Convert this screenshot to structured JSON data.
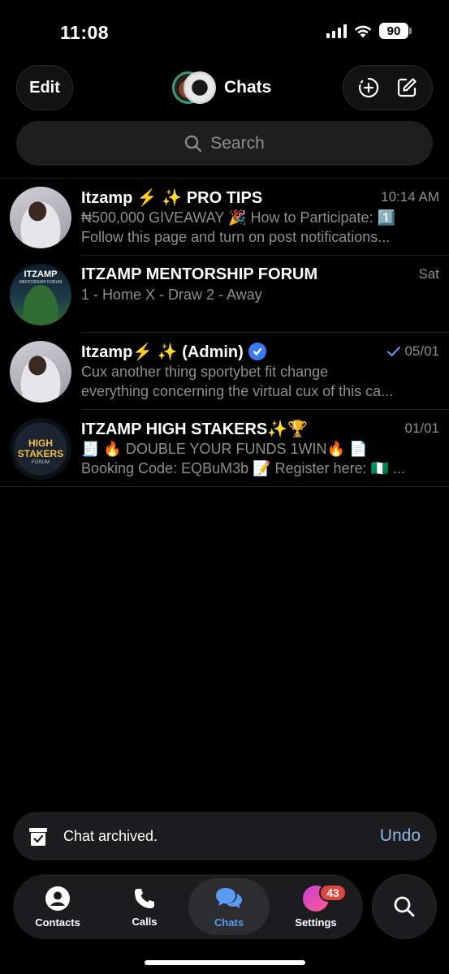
{
  "status_bar": {
    "time": "11:08",
    "battery": "90"
  },
  "header": {
    "edit_label": "Edit",
    "title": "Chats"
  },
  "search": {
    "placeholder": "Search"
  },
  "chats": [
    {
      "name": "Itzamp ⚡️ ✨ PRO TIPS",
      "date": "10:14 AM",
      "line1": "₦500,000 GIVEAWAY 🎉 How to Participate: 1️⃣",
      "line2": "Follow this page and turn on post notifications...",
      "avatar": "sleeping-man"
    },
    {
      "name": "ITZAMP MENTORSHIP FORUM",
      "date": "Sat",
      "line1": "1 - Home X - Draw 2 - Away",
      "line2": "",
      "avatar": "mentorship-forum",
      "avatar_text": "ITZAMP",
      "avatar_subtext": "MENTORSHIP FORUM"
    },
    {
      "name": "Itzamp⚡️ ✨ (Admin)",
      "date": "05/01",
      "line1": "Cux another thing sportybet fit change",
      "line2": "everything concerning the virtual cux of this ca...",
      "avatar": "sleeping-man",
      "verified": true,
      "read_check": true
    },
    {
      "name": "ITZAMP HIGH STAKERS✨🏆",
      "date": "01/01",
      "line1": "🧾 🔥 DOUBLE YOUR FUNDS 1WIN🔥 📄",
      "line2": "Booking Code: EQBuM3b 📝 Register here: 🇳🇬 ...",
      "avatar": "high-stakers",
      "avatar_line1": "HIGH",
      "avatar_line2": "STAKERS",
      "avatar_line3": "FORUM"
    }
  ],
  "toast": {
    "text": "Chat archived.",
    "action": "Undo"
  },
  "tabbar": {
    "tabs": [
      {
        "label": "Contacts",
        "icon": "person-circle-icon"
      },
      {
        "label": "Calls",
        "icon": "phone-icon"
      },
      {
        "label": "Chats",
        "icon": "chat-bubbles-icon",
        "active": true
      },
      {
        "label": "Settings",
        "icon": "avatar-icon",
        "badge": "43"
      }
    ]
  },
  "colors": {
    "accent": "#5b9af5",
    "badge": "#e0473c",
    "undo": "#8cb7e6",
    "verified": "#3a7bf5"
  }
}
